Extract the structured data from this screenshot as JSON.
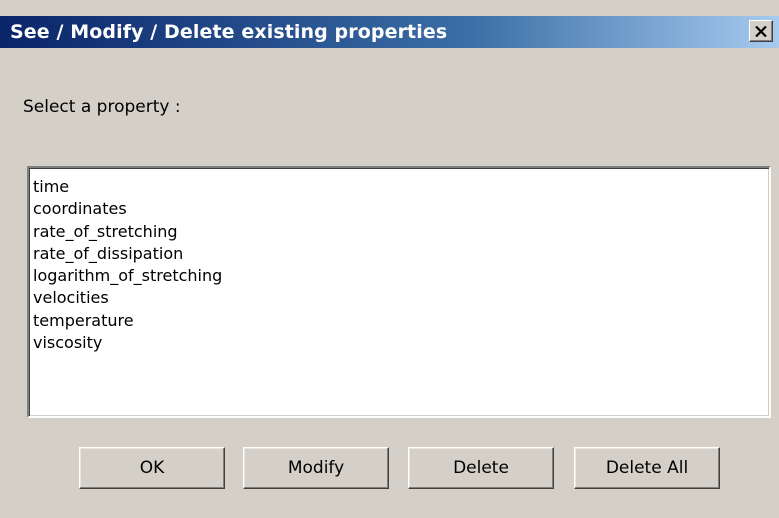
{
  "window": {
    "title": "See / Modify / Delete existing properties",
    "close_icon": "close-x-icon"
  },
  "prompt": "Select a property :",
  "properties": [
    "time",
    "coordinates",
    "rate_of_stretching",
    "rate_of_dissipation",
    "logarithm_of_stretching",
    "velocities",
    "temperature",
    "viscosity"
  ],
  "buttons": {
    "ok": "OK",
    "modify": "Modify",
    "delete": "Delete",
    "delete_all": "Delete All"
  },
  "colors": {
    "title_gradient_start": "#0a246a",
    "title_gradient_end": "#a6caf0",
    "dialog_background": "#d4d0c8"
  }
}
